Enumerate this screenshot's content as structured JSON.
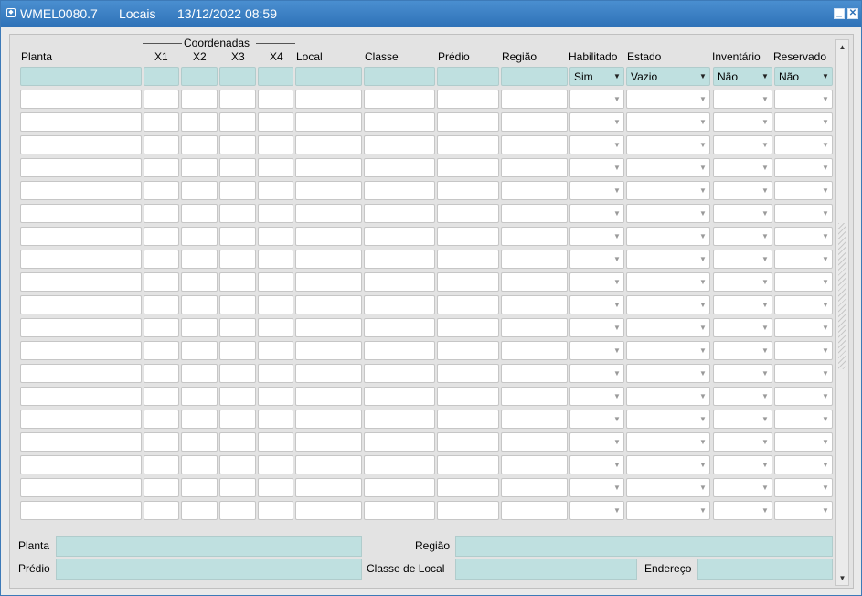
{
  "window": {
    "code": "WMEL0080.7",
    "title": "Locais",
    "datetime": "13/12/2022 08:59"
  },
  "columns": {
    "group_label": "Coordenadas",
    "planta": "Planta",
    "x1": "X1",
    "x2": "X2",
    "x3": "X3",
    "x4": "X4",
    "local": "Local",
    "classe": "Classe",
    "predio": "Prédio",
    "regiao": "Região",
    "habilitado": "Habilitado",
    "estado": "Estado",
    "inventario": "Inventário",
    "reservado": "Reservado"
  },
  "query_row": {
    "habilitado": "Sim",
    "estado": "Vazio",
    "inventario": "Não",
    "reservado": "Não"
  },
  "footer": {
    "planta_label": "Planta",
    "predio_label": "Prédio",
    "regiao_label": "Região",
    "classe_local_label": "Classe de Local",
    "endereco_label": "Endereço"
  },
  "colors": {
    "title_bar": "#2f72b8",
    "query_field": "#bfe0e0"
  }
}
